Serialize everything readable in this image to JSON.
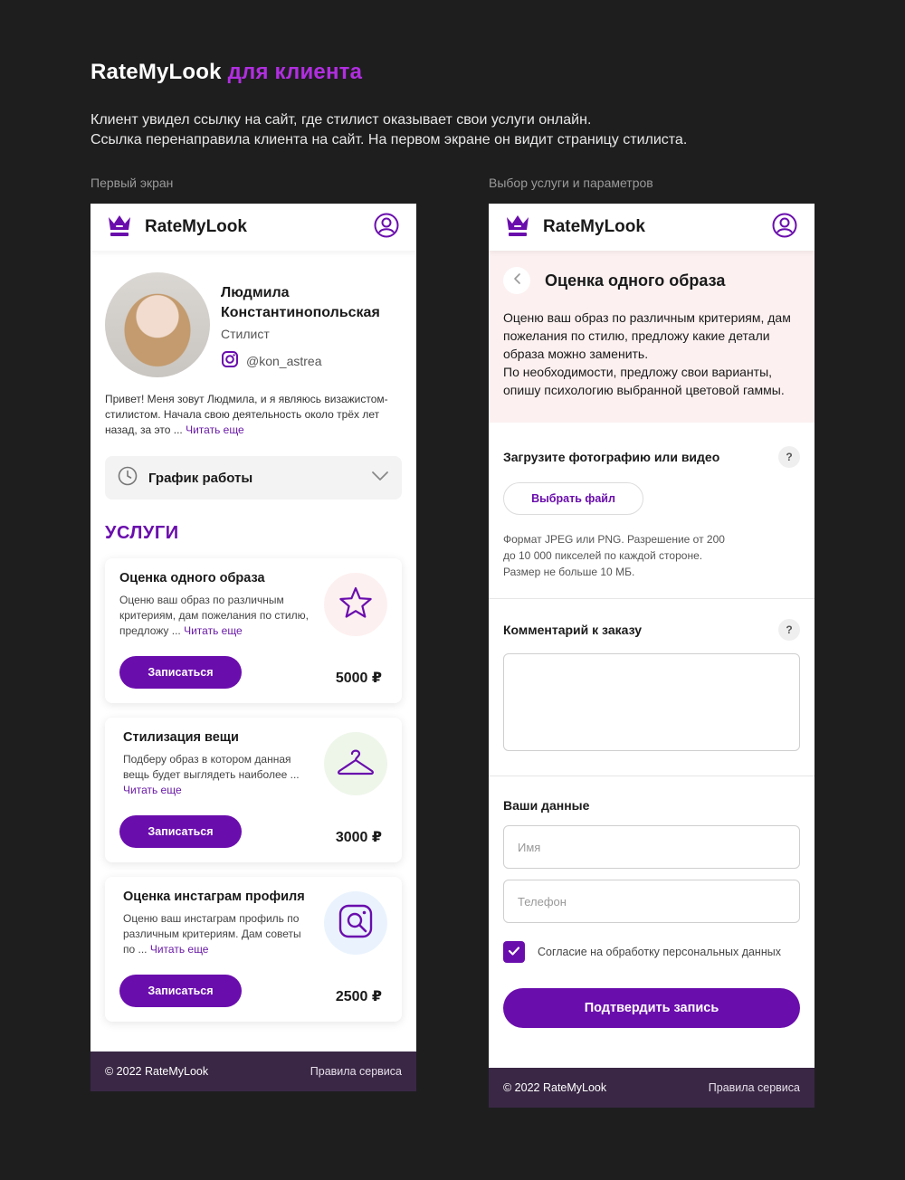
{
  "page": {
    "title_main": "RateMyLook",
    "title_accent": "для клиента",
    "intro": [
      "Клиент увидел ссылку на сайт, где стилист оказывает свои услуги онлайн.",
      "Ссылка перенаправила клиента на сайт. На первом экране он видит страницу стилиста."
    ],
    "label_left": "Первый экран",
    "label_right": "Выбор услуги и параметров"
  },
  "colors": {
    "brand": "#6a0dad",
    "accent": "#b12ee0",
    "footer": "#3a2745",
    "hero_bg": "#fcf0f0"
  },
  "app": {
    "brand": "RateMyLook",
    "logo_icon": "crown-icon",
    "user_icon": "user-circle-icon"
  },
  "profile": {
    "name_line1": "Людмила",
    "name_line2": "Константинопольская",
    "role": "Стилист",
    "instagram": "@kon_astrea",
    "bio": "Привет! Меня зовут Людмила, и я являюсь визажистом-стилистом. Начала свою деятельность около трёх лет назад, за это ... ",
    "read_more": "Читать еще"
  },
  "schedule": {
    "label": "График работы"
  },
  "services": {
    "title": "УСЛУГИ",
    "items": [
      {
        "title": "Оценка одного образа",
        "desc": "Оценю ваш образ по различным критериям, дам пожелания по стилю, предложу ... ",
        "more": "Читать еще",
        "button": "Записаться",
        "price": "5000 ₽",
        "icon": "star-icon",
        "icon_bg": "#fdf0f0"
      },
      {
        "title": "Стилизация вещи",
        "desc": "Подберу образ в котором данная вещь будет выглядеть наиболее ... ",
        "more": "Читать еще",
        "button": "Записаться",
        "price": "3000 ₽",
        "icon": "hanger-icon",
        "icon_bg": "#eef6ea"
      },
      {
        "title": "Оценка инстаграм профиля",
        "desc": "Оценю ваш инстаграм профиль по различным критериям. Дам советы по ... ",
        "more": "Читать еще",
        "button": "Записаться",
        "price": "2500 ₽",
        "icon": "instagram-search-icon",
        "icon_bg": "#eaf3fd"
      }
    ]
  },
  "footer": {
    "copyright": "© 2022 RateMyLook",
    "rules": "Правила сервиса"
  },
  "order": {
    "title": "Оценка одного образа",
    "description": "Оценю ваш образ по различным критериям, дам пожелания по стилю, предложу какие детали образа можно заменить.\nПо необходимости, предложу свои варианты, опишу психологию выбранной цветовой гаммы.",
    "upload_title": "Загрузите фотографию или видео",
    "upload_button": "Выбрать файл",
    "upload_hint": "Формат JPEG или PNG. Разрешение от 200\nдо 10 000 пикселей по каждой стороне.\nРазмер не больше 10 МБ.",
    "comment_title": "Комментарий к заказу",
    "comment_value": "",
    "help_label": "?",
    "data_title": "Ваши данные",
    "name_placeholder": "Имя",
    "phone_placeholder": "Телефон",
    "consent_label": "Согласие на обработку персональных данных",
    "consent_checked": true,
    "submit": "Подтвердить запись"
  }
}
